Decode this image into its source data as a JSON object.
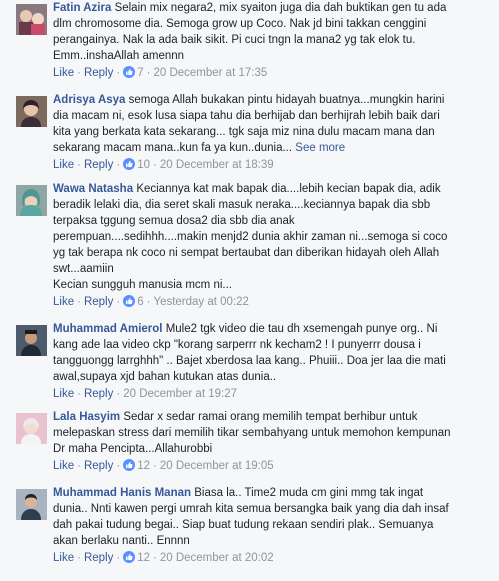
{
  "actions": {
    "like": "Like",
    "reply": "Reply",
    "dot": "·"
  },
  "comments": [
    {
      "author": "Fatin Azira",
      "lines": [
        "Selain mix negara2, mix syaiton juga dia dah buktikan gen tu ada",
        "dlm chromosome dia. Semoga grow up Coco. Nak jd bini takkan cenggini",
        "perangainya. Nak la ada baik sikit. Pi cuci tngn la mana2 yg tak elok tu.",
        "Emm..inshaAllah amennn"
      ],
      "reactions": "7",
      "timestamp": "20 December at 17:35"
    },
    {
      "author": "Adrisya Asya",
      "lines": [
        "semoga Allah bukakan pintu hidayah buatnya...mungkin harini",
        "dia macam ni, esok lusa siapa tahu dia berhijab dan berhijrah lebih baik dari",
        "kita yang berkata kata sekarang... tgk saja miz nina dulu macam mana dan",
        "sekarang macam mana..kun fa ya kun..dunia..."
      ],
      "see_more": "See more",
      "reactions": "10",
      "timestamp": "20 December at 18:39"
    },
    {
      "author": "Wawa Natasha",
      "lines": [
        "Keciannya kat mak bapak dia....lebih kecian bapak dia, adik",
        "beradik lelaki dia, dia seret skali masuk neraka....keciannya bapak dia sbb",
        "terpaksa tggung semua dosa2 dia sbb dia anak",
        "perempuan....sedihhh....makin menjd2 dunia akhir zaman ni...semoga si coco",
        "yg tak berapa nk coco ni sempat bertaubat dan diberikan hidayah oleh Allah",
        "swt...aamiin",
        "Kecian sungguh manusia mcm ni..."
      ],
      "reactions": "6",
      "timestamp": "Yesterday at 00:22"
    },
    {
      "author": "Muhammad Amierol",
      "lines": [
        "Mule2 tgk video die tau dh xsemengah punye org.. Ni",
        "kang ade laa video ckp \"korang sarperrr nk kecham2 ! I punyerrr dousa i",
        "tangguongg larrghhh\" .. Bajet xberdosa laa kang.. Phuiii.. Doa jer laa die mati",
        "awal,supaya xjd bahan kutukan atas dunia.."
      ],
      "reactions": "",
      "timestamp": "20 December at 19:27"
    },
    {
      "author": "Lala Hasyim",
      "lines": [
        "Sedar x sedar ramai orang memilih tempat berhibur untuk",
        "melepaskan stress dari memilih tikar sembahyang untuk memohon kempunan",
        "Dr maha Pencipta...Allahurobbi"
      ],
      "reactions": "12",
      "timestamp": "20 December at 19:05"
    },
    {
      "author": "Muhammad Hanis Manan",
      "lines": [
        "Biasa la.. Time2 muda cm gini mmg tak ingat",
        "dunia.. Nnti kawen pergi umrah kita semua bersangka baik yang dia dah insaf",
        "dah pakai tudung begai.. Siap buat tudung rekaan sendiri plak.. Semuanya",
        "akan berlaku nanti.. Ennnn"
      ],
      "reactions": "12",
      "timestamp": "20 December at 20:02"
    }
  ]
}
